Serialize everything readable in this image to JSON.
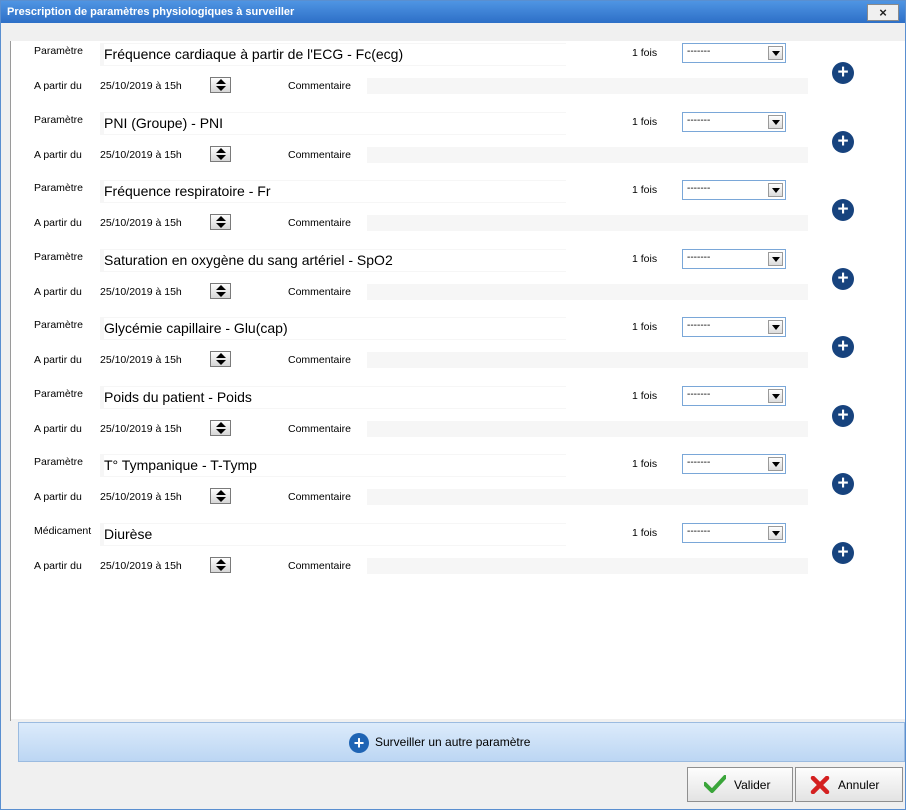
{
  "window": {
    "title": "Prescription de paramètres physiologiques à surveiller",
    "close_label": "×"
  },
  "labels": {
    "from": "A partir du",
    "comment": "Commentaire",
    "times": "1 fois"
  },
  "rows": [
    {
      "kind": "Paramètre",
      "name": "Fréquence cardiaque à partir de l'ECG - Fc(ecg)",
      "date": "25/10/2019 à 15h",
      "freq": "-------"
    },
    {
      "kind": "Paramètre",
      "name": "PNI (Groupe) - PNI",
      "date": "25/10/2019 à 15h",
      "freq": "-------"
    },
    {
      "kind": "Paramètre",
      "name": "Fréquence respiratoire - Fr",
      "date": "25/10/2019 à 15h",
      "freq": "-------"
    },
    {
      "kind": "Paramètre",
      "name": "Saturation en oxygène du sang artériel - SpO2",
      "date": "25/10/2019 à 15h",
      "freq": "-------"
    },
    {
      "kind": "Paramètre",
      "name": "Glycémie capillaire - Glu(cap)",
      "date": "25/10/2019 à 15h",
      "freq": "-------"
    },
    {
      "kind": "Paramètre",
      "name": "Poids du patient - Poids",
      "date": "25/10/2019 à 15h",
      "freq": "-------"
    },
    {
      "kind": "Paramètre",
      "name": "T° Tympanique - T-Tymp",
      "date": "25/10/2019 à 15h",
      "freq": "-------"
    },
    {
      "kind": "Médicament",
      "name": "Diurèse",
      "date": "25/10/2019 à 15h",
      "freq": "-------"
    }
  ],
  "footer": {
    "add_label": "Surveiller un autre paramètre",
    "ok_label": "Valider",
    "cancel_label": "Annuler"
  },
  "colors": {
    "title_bar": "#2d6fc7",
    "plus_icon": "#17437e",
    "ok_check": "#3aa53a",
    "cancel_cross": "#d42020"
  }
}
